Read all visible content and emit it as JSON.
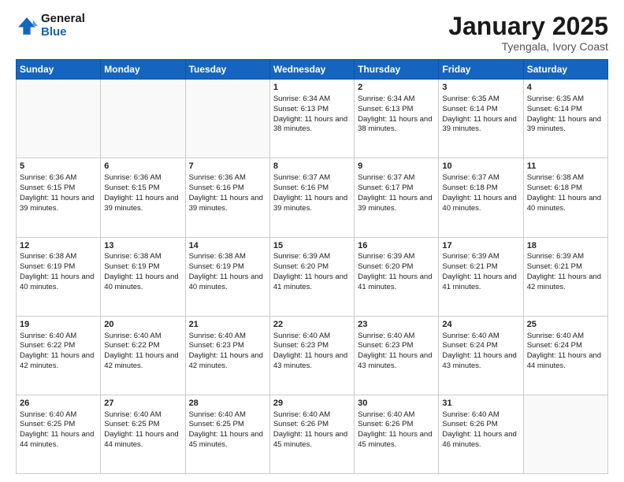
{
  "header": {
    "logo_line1": "General",
    "logo_line2": "Blue",
    "month_title": "January 2025",
    "subtitle": "Tyengala, Ivory Coast"
  },
  "days_of_week": [
    "Sunday",
    "Monday",
    "Tuesday",
    "Wednesday",
    "Thursday",
    "Friday",
    "Saturday"
  ],
  "weeks": [
    [
      {
        "day": "",
        "content": ""
      },
      {
        "day": "",
        "content": ""
      },
      {
        "day": "",
        "content": ""
      },
      {
        "day": "1",
        "content": "Sunrise: 6:34 AM\nSunset: 6:13 PM\nDaylight: 11 hours and 38 minutes."
      },
      {
        "day": "2",
        "content": "Sunrise: 6:34 AM\nSunset: 6:13 PM\nDaylight: 11 hours and 38 minutes."
      },
      {
        "day": "3",
        "content": "Sunrise: 6:35 AM\nSunset: 6:14 PM\nDaylight: 11 hours and 39 minutes."
      },
      {
        "day": "4",
        "content": "Sunrise: 6:35 AM\nSunset: 6:14 PM\nDaylight: 11 hours and 39 minutes."
      }
    ],
    [
      {
        "day": "5",
        "content": "Sunrise: 6:36 AM\nSunset: 6:15 PM\nDaylight: 11 hours and 39 minutes."
      },
      {
        "day": "6",
        "content": "Sunrise: 6:36 AM\nSunset: 6:15 PM\nDaylight: 11 hours and 39 minutes."
      },
      {
        "day": "7",
        "content": "Sunrise: 6:36 AM\nSunset: 6:16 PM\nDaylight: 11 hours and 39 minutes."
      },
      {
        "day": "8",
        "content": "Sunrise: 6:37 AM\nSunset: 6:16 PM\nDaylight: 11 hours and 39 minutes."
      },
      {
        "day": "9",
        "content": "Sunrise: 6:37 AM\nSunset: 6:17 PM\nDaylight: 11 hours and 39 minutes."
      },
      {
        "day": "10",
        "content": "Sunrise: 6:37 AM\nSunset: 6:18 PM\nDaylight: 11 hours and 40 minutes."
      },
      {
        "day": "11",
        "content": "Sunrise: 6:38 AM\nSunset: 6:18 PM\nDaylight: 11 hours and 40 minutes."
      }
    ],
    [
      {
        "day": "12",
        "content": "Sunrise: 6:38 AM\nSunset: 6:19 PM\nDaylight: 11 hours and 40 minutes."
      },
      {
        "day": "13",
        "content": "Sunrise: 6:38 AM\nSunset: 6:19 PM\nDaylight: 11 hours and 40 minutes."
      },
      {
        "day": "14",
        "content": "Sunrise: 6:38 AM\nSunset: 6:19 PM\nDaylight: 11 hours and 40 minutes."
      },
      {
        "day": "15",
        "content": "Sunrise: 6:39 AM\nSunset: 6:20 PM\nDaylight: 11 hours and 41 minutes."
      },
      {
        "day": "16",
        "content": "Sunrise: 6:39 AM\nSunset: 6:20 PM\nDaylight: 11 hours and 41 minutes."
      },
      {
        "day": "17",
        "content": "Sunrise: 6:39 AM\nSunset: 6:21 PM\nDaylight: 11 hours and 41 minutes."
      },
      {
        "day": "18",
        "content": "Sunrise: 6:39 AM\nSunset: 6:21 PM\nDaylight: 11 hours and 42 minutes."
      }
    ],
    [
      {
        "day": "19",
        "content": "Sunrise: 6:40 AM\nSunset: 6:22 PM\nDaylight: 11 hours and 42 minutes."
      },
      {
        "day": "20",
        "content": "Sunrise: 6:40 AM\nSunset: 6:22 PM\nDaylight: 11 hours and 42 minutes."
      },
      {
        "day": "21",
        "content": "Sunrise: 6:40 AM\nSunset: 6:23 PM\nDaylight: 11 hours and 42 minutes."
      },
      {
        "day": "22",
        "content": "Sunrise: 6:40 AM\nSunset: 6:23 PM\nDaylight: 11 hours and 43 minutes."
      },
      {
        "day": "23",
        "content": "Sunrise: 6:40 AM\nSunset: 6:23 PM\nDaylight: 11 hours and 43 minutes."
      },
      {
        "day": "24",
        "content": "Sunrise: 6:40 AM\nSunset: 6:24 PM\nDaylight: 11 hours and 43 minutes."
      },
      {
        "day": "25",
        "content": "Sunrise: 6:40 AM\nSunset: 6:24 PM\nDaylight: 11 hours and 44 minutes."
      }
    ],
    [
      {
        "day": "26",
        "content": "Sunrise: 6:40 AM\nSunset: 6:25 PM\nDaylight: 11 hours and 44 minutes."
      },
      {
        "day": "27",
        "content": "Sunrise: 6:40 AM\nSunset: 6:25 PM\nDaylight: 11 hours and 44 minutes."
      },
      {
        "day": "28",
        "content": "Sunrise: 6:40 AM\nSunset: 6:25 PM\nDaylight: 11 hours and 45 minutes."
      },
      {
        "day": "29",
        "content": "Sunrise: 6:40 AM\nSunset: 6:26 PM\nDaylight: 11 hours and 45 minutes."
      },
      {
        "day": "30",
        "content": "Sunrise: 6:40 AM\nSunset: 6:26 PM\nDaylight: 11 hours and 45 minutes."
      },
      {
        "day": "31",
        "content": "Sunrise: 6:40 AM\nSunset: 6:26 PM\nDaylight: 11 hours and 46 minutes."
      },
      {
        "day": "",
        "content": ""
      }
    ]
  ]
}
